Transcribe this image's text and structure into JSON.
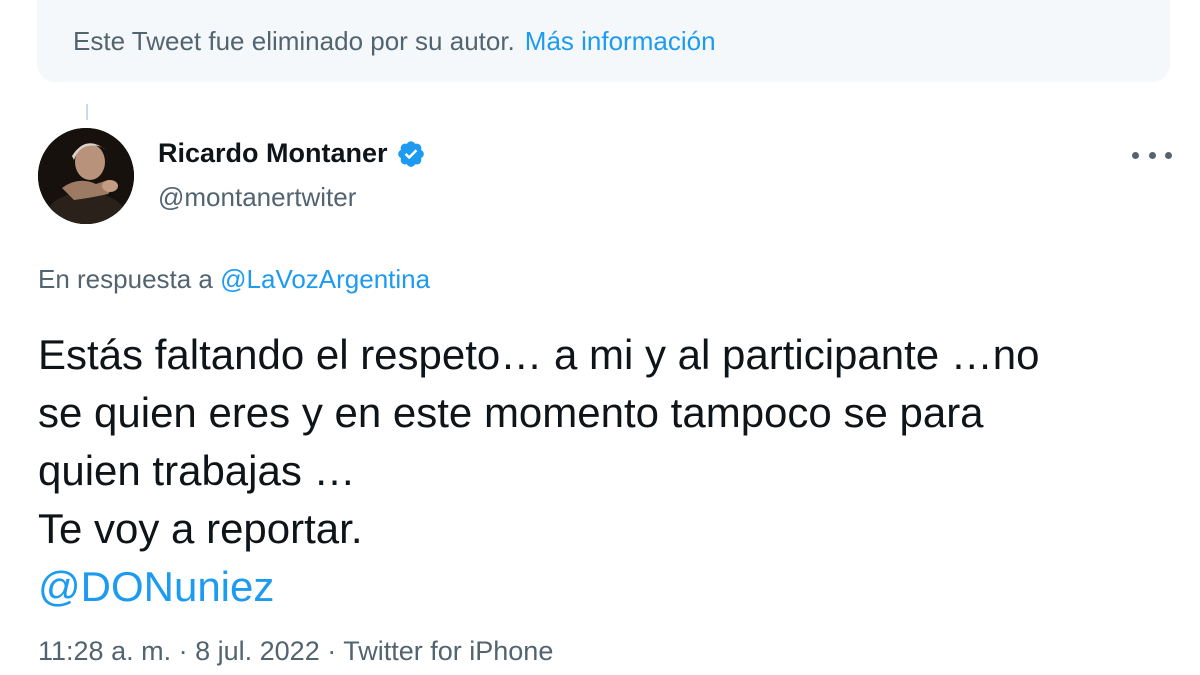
{
  "deleted_notice": {
    "text": "Este Tweet fue eliminado por su autor.",
    "link": "Más información"
  },
  "author": {
    "display_name": "Ricardo Montaner",
    "handle": "@montanertwiter",
    "verified": true,
    "avatar_icon": "profile-photo"
  },
  "reply": {
    "prefix": "En respuesta a",
    "mention": "@LaVozArgentina"
  },
  "tweet": {
    "lines": [
      "Estás faltando el respeto… a mi y al participante …no",
      "se quien eres y en este momento tampoco se para",
      "quien trabajas …",
      "Te voy a reportar."
    ],
    "mention": "@DONuniez"
  },
  "meta": {
    "time": "11:28 a. m.",
    "separator": "·",
    "date": "8 jul. 2022",
    "source": "Twitter for iPhone"
  },
  "colors": {
    "link": "#1d9bf0",
    "secondary_text": "#536471",
    "primary_text": "#0f1419",
    "deleted_box_bg": "#f5f8fa"
  }
}
